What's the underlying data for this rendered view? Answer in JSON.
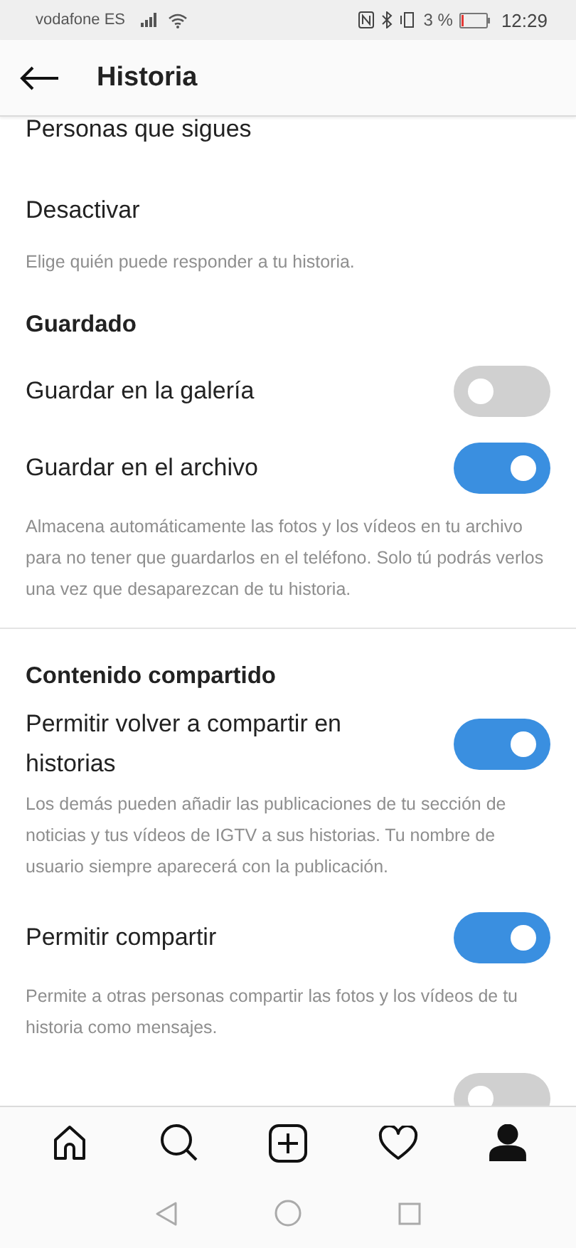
{
  "status_bar": {
    "carrier": "vodafone ES",
    "battery": "3 %",
    "time": "12:29"
  },
  "header": {
    "title": "Historia"
  },
  "items": [
    {
      "kind": "option",
      "label": "Personas que sigues"
    },
    {
      "kind": "option",
      "label": "Desactivar"
    },
    {
      "kind": "hint",
      "text": "Elige quién puede responder a tu historia."
    },
    {
      "kind": "header",
      "text": "Guardado"
    },
    {
      "kind": "toggle",
      "label": "Guardar en la galería",
      "on": false
    },
    {
      "kind": "toggle",
      "label": "Guardar en el archivo",
      "on": true
    },
    {
      "kind": "hint",
      "text": "Almacena automáticamente las fotos y los vídeos en tu archivo para no tener que guardarlos en el teléfono. Solo tú podrás verlos una vez que desaparezcan de tu historia."
    },
    {
      "kind": "divider"
    },
    {
      "kind": "header",
      "text": "Contenido compartido"
    },
    {
      "kind": "toggle",
      "label": "Permitir volver a compartir en historias",
      "on": true
    },
    {
      "kind": "hint",
      "text": "Los demás pueden añadir las publicaciones de tu sección de noticias y tus vídeos de IGTV a sus historias. Tu nombre de usuario siempre aparecerá con la publicación."
    },
    {
      "kind": "toggle",
      "label": "Permitir compartir",
      "on": true
    },
    {
      "kind": "hint",
      "text": "Permite a otras personas compartir las fotos y los vídeos de tu historia como mensajes."
    },
    {
      "kind": "toggle",
      "on": false
    }
  ],
  "tab_bar": [
    {
      "kind": "home",
      "selected": false
    },
    {
      "kind": "search",
      "selected": false
    },
    {
      "kind": "add",
      "selected": false
    },
    {
      "kind": "heart",
      "selected": false
    },
    {
      "kind": "profile",
      "selected": true
    }
  ]
}
